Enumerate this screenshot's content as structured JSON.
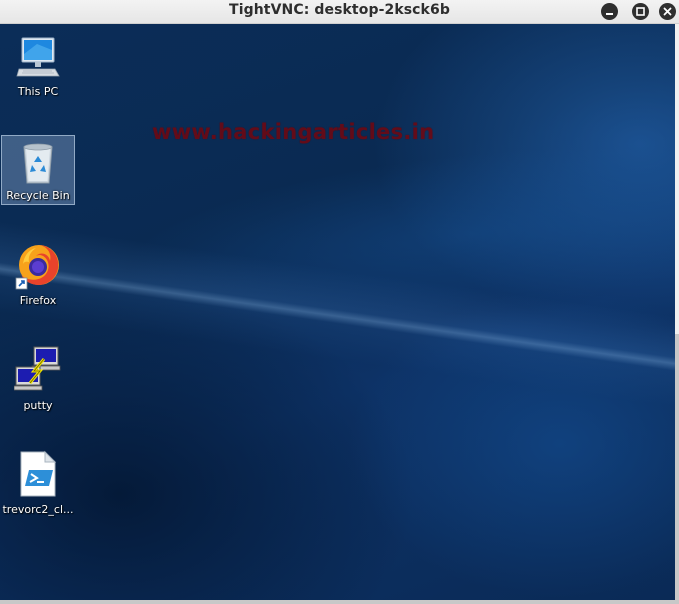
{
  "window": {
    "title": "TightVNC: desktop-2ksck6b"
  },
  "watermark": "www.hackingarticles.in",
  "desktop": {
    "icons": [
      {
        "label": "This PC",
        "icon": "computer-icon",
        "selected": false
      },
      {
        "label": "Recycle Bin",
        "icon": "recycle-bin-icon",
        "selected": true
      },
      {
        "label": "Firefox",
        "icon": "firefox-icon",
        "selected": false
      },
      {
        "label": "putty",
        "icon": "putty-icon",
        "selected": false
      },
      {
        "label": "trevorc2_cl...",
        "icon": "powershell-script-icon",
        "selected": false
      }
    ]
  },
  "colors": {
    "desktop_background": "#0a2a52",
    "titlebar": "#ececec",
    "watermark": "#780a14"
  }
}
